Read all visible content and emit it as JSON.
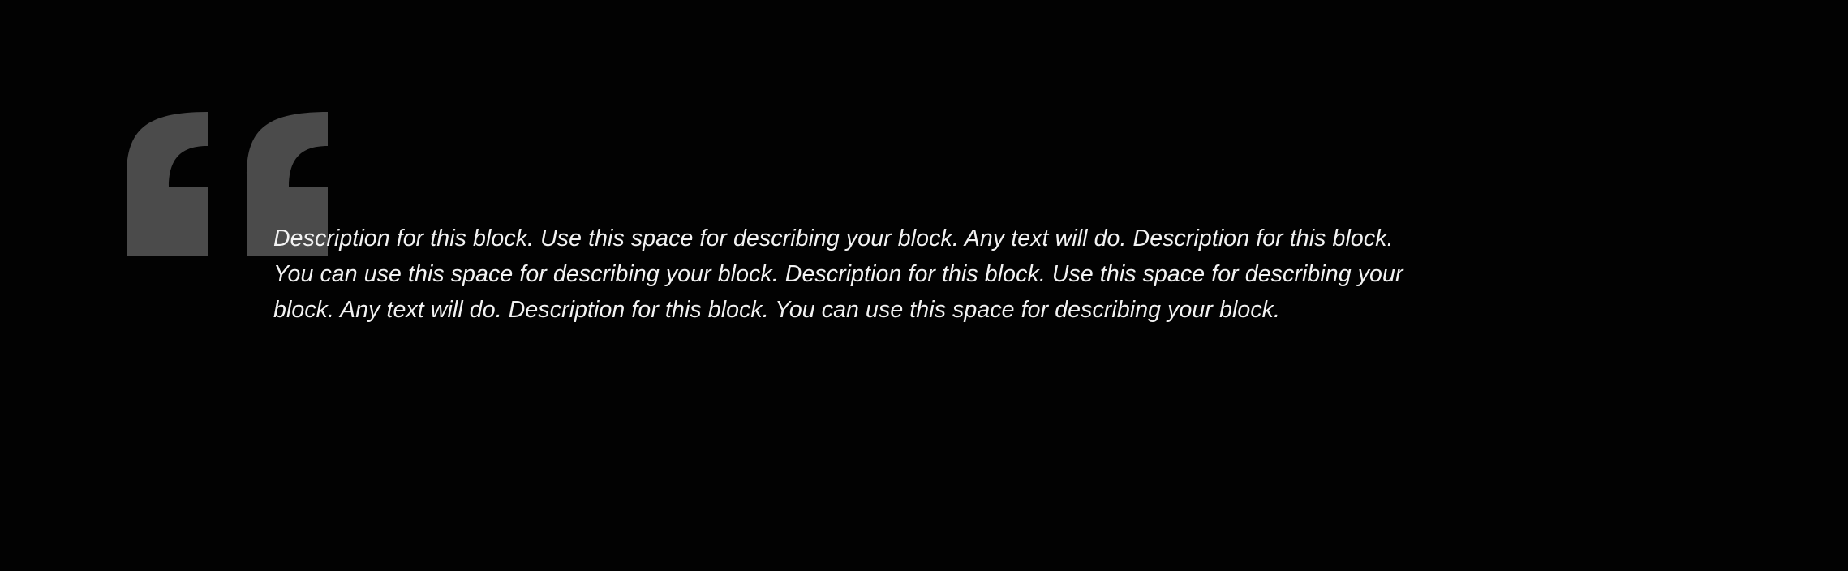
{
  "quote": {
    "text": "Description for this block. Use this space for describing your block. Any text will do. Description for this block. You can use this space for describing your block. Description for this block. Use this space for describing your block. Any text will do. Description for this block. You can use this space for describing your block.",
    "icon": "quote-open-icon"
  },
  "colors": {
    "background": "#020202",
    "text": "#f2f2f2",
    "quote_mark": "#4b4b4b"
  }
}
